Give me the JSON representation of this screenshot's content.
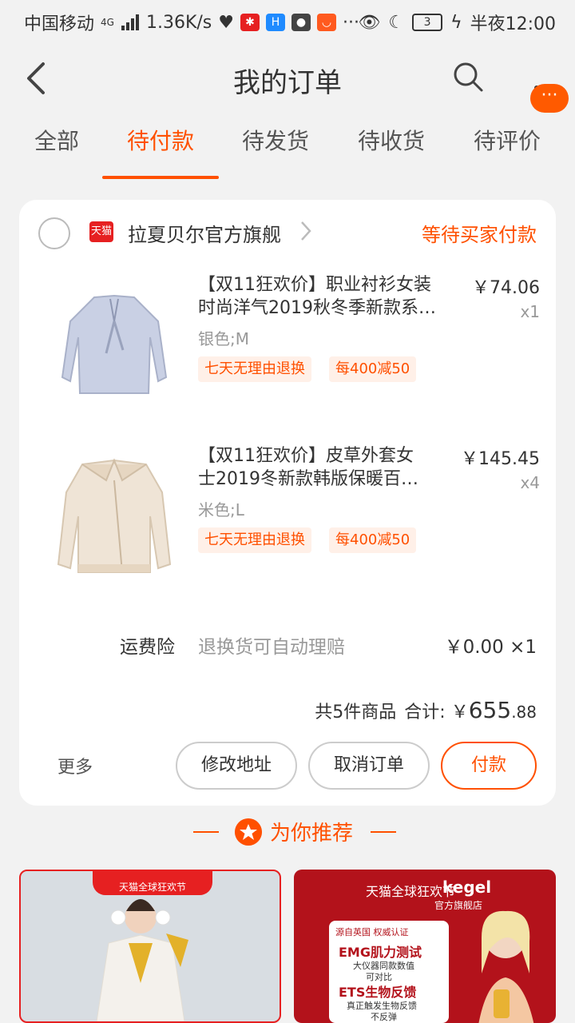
{
  "status_bar": {
    "carrier": "中国移动",
    "network": "4G",
    "speed": "1.36K/s",
    "battery": "3",
    "time": "半夜12:00"
  },
  "header": {
    "title": "我的订单",
    "float_badge": "···"
  },
  "tabs": [
    {
      "label": "全部"
    },
    {
      "label": "待付款"
    },
    {
      "label": "待发货"
    },
    {
      "label": "待收货"
    },
    {
      "label": "待评价"
    }
  ],
  "active_tab": 1,
  "order": {
    "store_logo_text": "天猫",
    "store_name": "拉夏贝尔官方旗舰",
    "status": "等待买家付款",
    "items": [
      {
        "title_line1": "【双11狂欢价】职业衬衫女装",
        "title_line2": "时尚洋气2019秋冬季新款系…",
        "price": "￥74.06",
        "qty": "x1",
        "spec": "银色;M",
        "tags": [
          "七天无理由退换",
          "每400减50"
        ]
      },
      {
        "title_line1": "【双11狂欢价】皮草外套女",
        "title_line2": "士2019冬新款韩版保暖百…",
        "price": "￥145.45",
        "qty": "x4",
        "spec": "米色;L",
        "tags": [
          "七天无理由退换",
          "每400减50"
        ]
      }
    ],
    "insurance": {
      "label": "运费险",
      "desc": "退换货可自动理赔",
      "price": "￥0.00 ×1"
    },
    "total": {
      "count_text": "共5件商品",
      "label": "合计:",
      "currency": "￥",
      "integer": "655",
      "decimal": ".88"
    },
    "actions": {
      "more": "更多",
      "modify_address": "修改地址",
      "cancel_order": "取消订单",
      "pay": "付款"
    }
  },
  "recommend": {
    "title": "为你推荐",
    "card1_banner": "天猫全球狂欢节",
    "card2": {
      "head": "天猫全球狂欢节",
      "brand": "kegel",
      "sub": "官方旗舰店",
      "tags": "源自英国 权威认证",
      "line1": "EMG肌力测试",
      "line2": "大仪器同款数值",
      "line3": "可对比",
      "line4": "ETS生物反馈",
      "line5": "真正触发生物反馈",
      "line6": "不反弹"
    }
  },
  "colors": {
    "accent": "#ff5000",
    "tmall_red": "#e62021",
    "page_bg": "#f2f2f2"
  }
}
